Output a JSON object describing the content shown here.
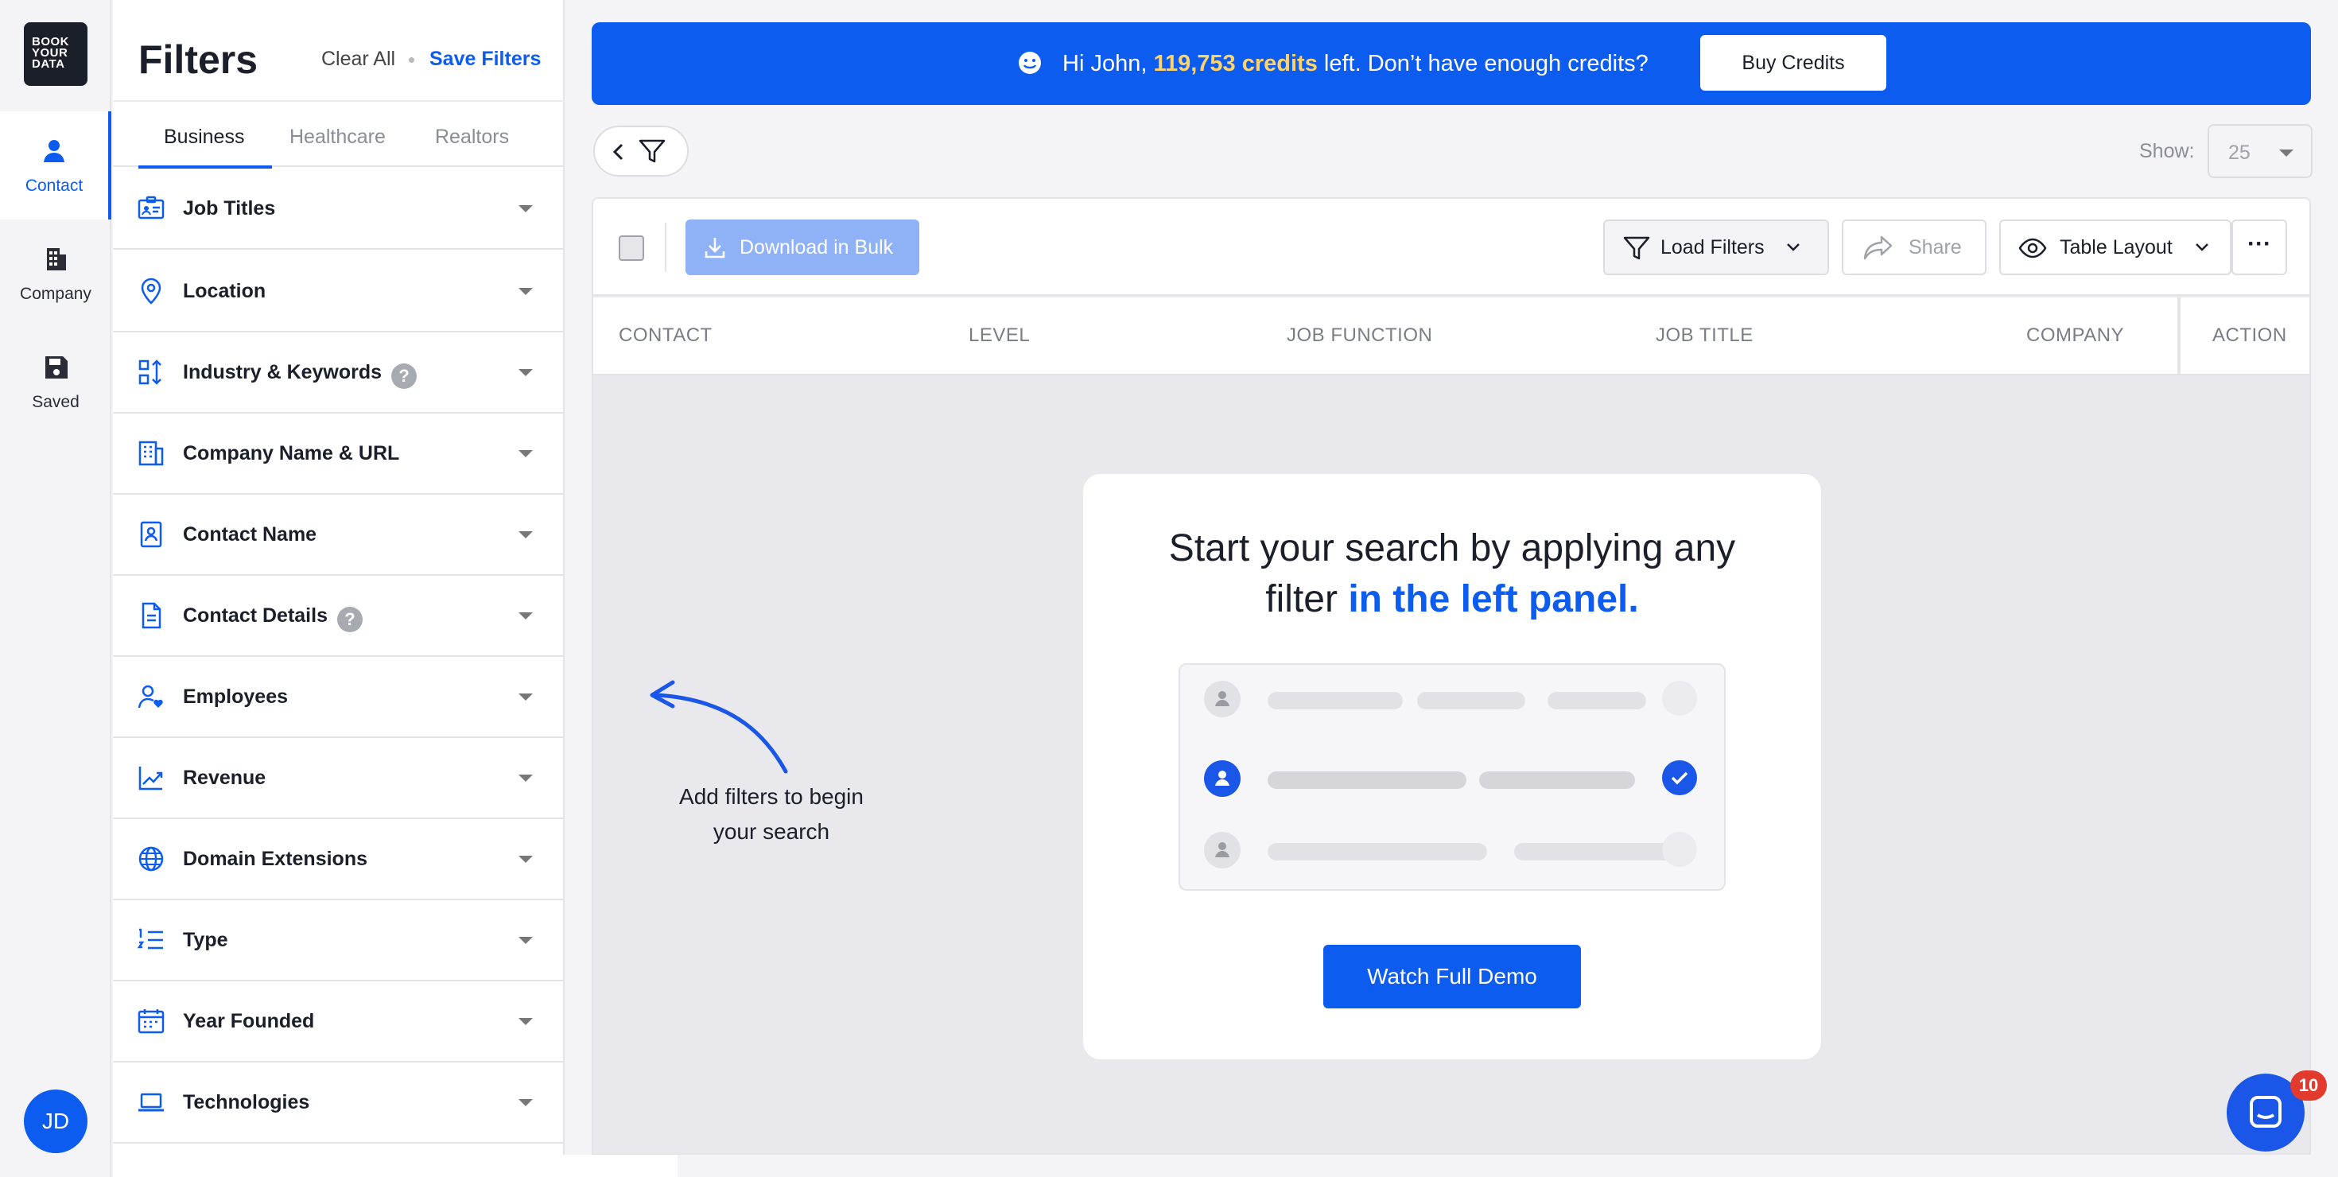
{
  "app": {
    "logo_text": "BOOK YOUR DATA",
    "user_initials": "JD",
    "accent": "#0d5cf0"
  },
  "rail": {
    "items": [
      {
        "label": "Contact",
        "icon": "person-icon",
        "active": true
      },
      {
        "label": "Company",
        "icon": "building-icon",
        "active": false
      },
      {
        "label": "Saved",
        "icon": "save-icon",
        "active": false
      }
    ]
  },
  "filters": {
    "title": "Filters",
    "clear_all": "Clear All",
    "save_filters": "Save Filters",
    "tabs": [
      "Business",
      "Healthcare",
      "Realtors"
    ],
    "active_tab": "Business",
    "items": [
      {
        "label": "Job Titles",
        "icon": "id-card-icon",
        "help": false
      },
      {
        "label": "Location",
        "icon": "map-pin-icon",
        "help": false
      },
      {
        "label": "Industry & Keywords",
        "icon": "sort-icon",
        "help": true
      },
      {
        "label": "Company Name & URL",
        "icon": "office-building-icon",
        "help": false
      },
      {
        "label": "Contact Name",
        "icon": "contact-book-icon",
        "help": false
      },
      {
        "label": "Contact Details",
        "icon": "document-icon",
        "help": true
      },
      {
        "label": "Employees",
        "icon": "user-heart-icon",
        "help": false
      },
      {
        "label": "Revenue",
        "icon": "trend-chart-icon",
        "help": false
      },
      {
        "label": "Domain Extensions",
        "icon": "globe-icon",
        "help": false
      },
      {
        "label": "Type",
        "icon": "list-numbers-icon",
        "help": false
      },
      {
        "label": "Year Founded",
        "icon": "calendar-icon",
        "help": false
      },
      {
        "label": "Technologies",
        "icon": "laptop-icon",
        "help": false
      }
    ],
    "help_glyph": "?"
  },
  "banner": {
    "greeting": "Hi John, ",
    "credits": "119,753 credits",
    "rest": " left. Don’t have enough credits?",
    "buy_label": "Buy Credits"
  },
  "controls": {
    "show_label": "Show:",
    "show_value": "25"
  },
  "toolbar": {
    "download_label": "Download in Bulk",
    "load_filters_label": "Load Filters",
    "share_label": "Share",
    "table_layout_label": "Table Layout",
    "more_glyph": "···"
  },
  "table": {
    "columns": [
      "CONTACT",
      "LEVEL",
      "JOB FUNCTION",
      "JOB TITLE",
      "COMPANY",
      "ACTION"
    ]
  },
  "empty_state": {
    "title_line1": "Start your search by applying any",
    "title_line2_plain": "filter ",
    "title_line2_blue": "in the left panel.",
    "demo_label": "Watch Full Demo",
    "hint_line1": "Add filters to begin",
    "hint_line2": "your search"
  },
  "chat": {
    "badge": "10"
  }
}
